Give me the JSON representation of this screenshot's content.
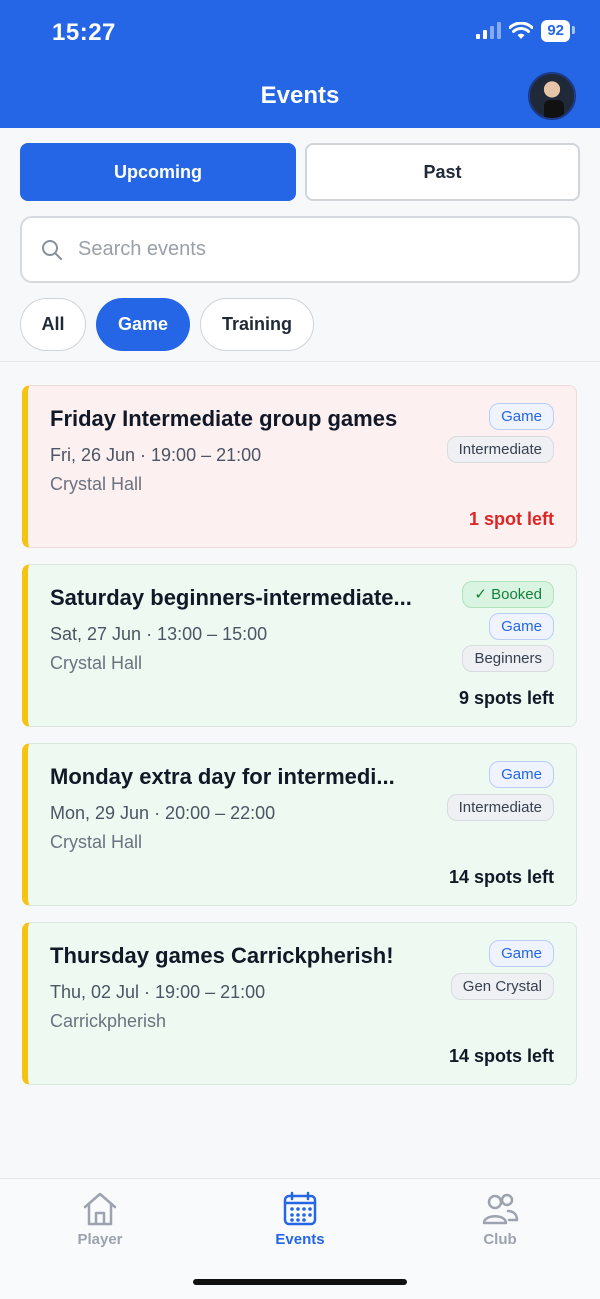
{
  "status_bar": {
    "time": "15:27",
    "battery": "92"
  },
  "header": {
    "title": "Events"
  },
  "segments": {
    "upcoming": "Upcoming",
    "past": "Past"
  },
  "search": {
    "placeholder": "Search events",
    "value": ""
  },
  "filters": {
    "all": "All",
    "game": "Game",
    "training": "Training"
  },
  "events": [
    {
      "title": "Friday Intermediate group games",
      "date": "Fri, 26 Jun · 19:00 – 21:00",
      "location": "Crystal Hall",
      "type_badge": "Game",
      "level_badge": "Intermediate",
      "spots": "1 spot left"
    },
    {
      "title": "Saturday beginners-intermediate...",
      "date": "Sat, 27 Jun · 13:00 – 15:00",
      "location": "Crystal Hall",
      "booked_badge": "✓ Booked",
      "type_badge": "Game",
      "level_badge": "Beginners",
      "spots": "9 spots left"
    },
    {
      "title": "Monday extra day for intermedi...",
      "date": "Mon, 29 Jun · 20:00 – 22:00",
      "location": "Crystal Hall",
      "type_badge": "Game",
      "level_badge": "Intermediate",
      "spots": "14 spots left"
    },
    {
      "title": "Thursday games Carrickpherish!",
      "date": "Thu, 02 Jul · 19:00 – 21:00",
      "location": "Carrickpherish",
      "type_badge": "Game",
      "level_badge": "Gen Crystal",
      "spots": "14 spots left"
    }
  ],
  "tabs": {
    "player": "Player",
    "events": "Events",
    "club": "Club"
  },
  "colors": {
    "primary": "#2466e5",
    "accent_stripe": "#f5c314",
    "urgent": "#dc2626",
    "booked": "#15803d"
  }
}
